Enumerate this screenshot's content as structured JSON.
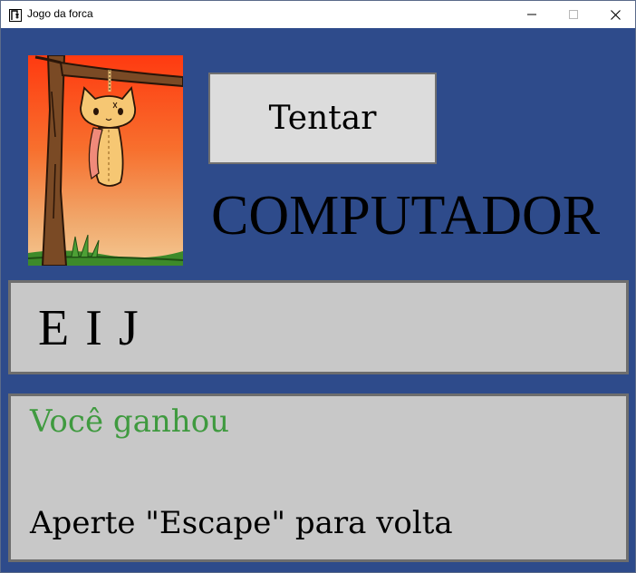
{
  "window": {
    "title": "Jogo da forca",
    "icon": "hangman-app-icon",
    "controls": [
      "minimize-icon",
      "maximize-icon",
      "close-icon"
    ]
  },
  "game": {
    "image": "hanging-cat-under-tree",
    "try_button_label": "Tentar",
    "category": "COMPUTADOR",
    "guessed_letters": "E I J",
    "status_message": "Você ganhou",
    "hint_message": "Aperte \"Escape\" para volta"
  },
  "colors": {
    "background": "#2e4b8b",
    "panel": "#c8c8c8",
    "button": "#dcdcdc",
    "status_green": "#3f9a3f"
  }
}
